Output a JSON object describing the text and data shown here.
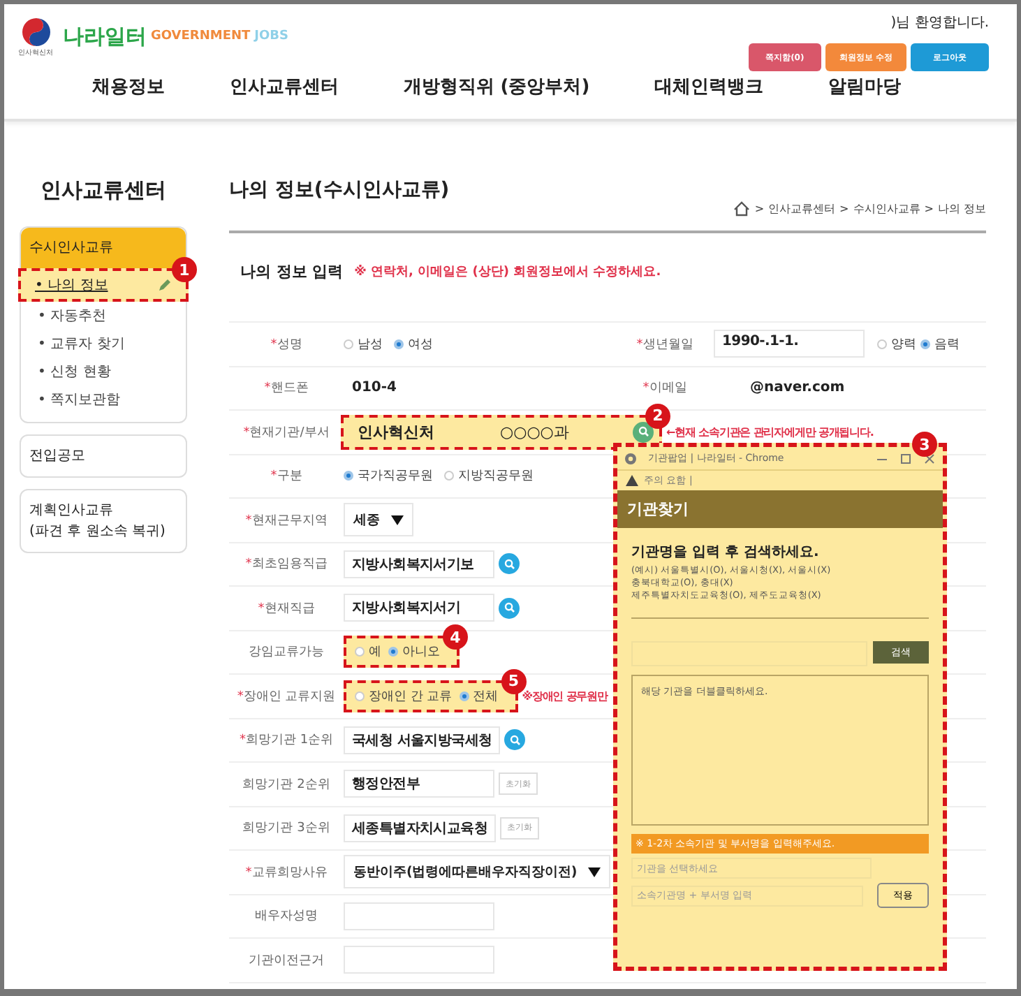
{
  "header": {
    "emblem_caption": "인사혁신처",
    "logo": "나라일터",
    "brand_words": [
      {
        "text": "GOVERNMENT",
        "color": "#f08a3c"
      },
      {
        "text": "JOBS",
        "color": "#8fd0e8"
      }
    ],
    "welcome": ")님 환영합니다.",
    "buttons": [
      {
        "label": "쪽지함(0)",
        "color": "#d9576a"
      },
      {
        "label": "회원정보 수정",
        "color": "#f3893b"
      },
      {
        "label": "로그아웃",
        "color": "#1e9ad6"
      }
    ],
    "nav": [
      "채용정보",
      "인사교류센터",
      "개방형직위 (중앙부처)",
      "대체인력뱅크",
      "알림마당"
    ]
  },
  "sidebar": {
    "title": "인사교류센터",
    "groups": [
      {
        "lines": [
          "수시인사교류"
        ],
        "selected": true,
        "children": [
          {
            "label": "• 나의 정보",
            "selected": true,
            "callout": "1"
          },
          {
            "label": "• 자동추천",
            "selected": false
          },
          {
            "label": "• 교류자 찾기",
            "selected": false
          },
          {
            "label": "• 신청 현황",
            "selected": false
          },
          {
            "label": "• 쪽지보관함",
            "selected": false
          }
        ]
      },
      {
        "lines": [
          "전입공모"
        ],
        "selected": false
      },
      {
        "lines": [
          "계획인사교류",
          "(파견 후 원소속 복귀)"
        ],
        "selected": false
      }
    ]
  },
  "main": {
    "title": "나의 정보(수시인사교류)",
    "breadcrumb_separator": ">",
    "breadcrumb": [
      "인사교류센터",
      "수시인사교류",
      "나의 정보"
    ],
    "section": "나의 정보 입력",
    "notice": "※ 연락처, 이메일은 (상단) 회원정보에서 수정하세요.",
    "rows": [
      {
        "mark": "*",
        "label": "성명",
        "kind": "radio",
        "options": [
          {
            "label": "남성",
            "selected": false
          },
          {
            "label": "여성",
            "selected": true
          }
        ],
        "side": {
          "mark": "*",
          "label": "생년월일",
          "kind": "date",
          "value": "1990-.1-1.",
          "options": [
            {
              "label": "양력",
              "selected": false
            },
            {
              "label": "음력",
              "selected": true
            }
          ]
        }
      },
      {
        "mark": "*",
        "label": "핸드폰",
        "kind": "text",
        "value": "010-4",
        "side": {
          "mark": "*",
          "label": "이메일",
          "kind": "text",
          "value": "@naver.com"
        }
      },
      {
        "mark": "*",
        "label": "현재기관/부서",
        "kind": "dept",
        "fields": [
          "인사혁신처",
          "○○○○과"
        ],
        "note": "←현재 소속기관은 관리자에게만 공개됩니다.",
        "callout": "2"
      },
      {
        "mark": "*",
        "label": "구분",
        "kind": "radio",
        "options": [
          {
            "label": "국가직공무원",
            "selected": true
          },
          {
            "label": "지방직공무원",
            "selected": false
          }
        ]
      },
      {
        "mark": "*",
        "label": "현재근무지역",
        "kind": "select",
        "value": "세종"
      },
      {
        "mark": "*",
        "label": "최초임용직급",
        "kind": "search",
        "value": "지방사회복지서기보"
      },
      {
        "mark": "*",
        "label": "현재직급",
        "kind": "search",
        "value": "지방사회복지서기"
      },
      {
        "label": "강임교류가능",
        "kind": "radio",
        "options": [
          {
            "label": "예",
            "selected": false
          },
          {
            "label": "아니오",
            "selected": true
          }
        ],
        "callout": "4"
      },
      {
        "mark": "*",
        "label": "장애인 교류지원",
        "kind": "radio",
        "options": [
          {
            "label": "장애인 간 교류",
            "selected": false
          },
          {
            "label": "전체",
            "selected": true
          }
        ],
        "note": "※장애인 공무원만",
        "callout": "5"
      },
      {
        "mark": "*",
        "label": "희망기관 1순위",
        "kind": "search",
        "value": "국세청 서울지방국세청"
      },
      {
        "label": "희망기관 2순위",
        "kind": "reset",
        "value": "행정안전부",
        "button": "초기화"
      },
      {
        "label": "희망기관 3순위",
        "kind": "reset",
        "value": "세종특별자치시교육청",
        "button": "초기화"
      },
      {
        "mark": "*",
        "label": "교류희망사유",
        "kind": "select",
        "value": "동반이주(법령에따른배우자직장이전)"
      },
      {
        "label": "배우자성명",
        "kind": "input"
      },
      {
        "label": "기관이전근거",
        "kind": "input"
      }
    ]
  },
  "popup": {
    "callout": "3",
    "window_title": "기관팝업 | 나라일터 - Chrome",
    "warning": "주의 요함 |",
    "header": "기관찾기",
    "heading": "기관명을 입력 후 검색하세요.",
    "examples": [
      "(예시) 서울특별시(O), 서울시청(X), 서울시(X)",
      "충북대학교(O), 충대(X)",
      "제주특별자치도교육청(O), 제주도교육청(X)"
    ],
    "search_button": "검색",
    "list_placeholder": "해당 기관을 더블클릭하세요.",
    "note": "※ 1-2차 소속기관 및 부서명을 입력해주세요.",
    "field1_placeholder": "기관을 선택하세요",
    "field2_placeholder": "소속기관명 + 부서명 입력",
    "apply_button": "적용"
  }
}
